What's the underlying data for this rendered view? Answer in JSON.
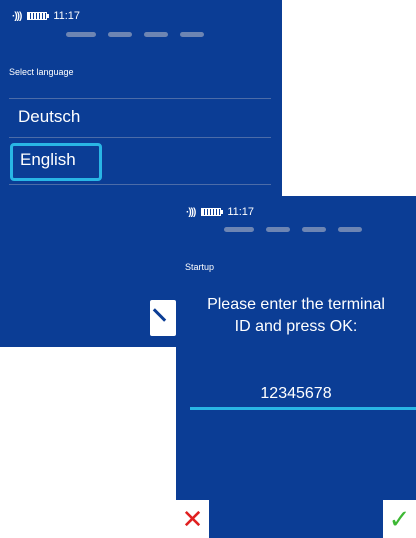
{
  "screen1": {
    "status": {
      "nfc_icon": "contactless-icon",
      "battery_icon": "battery-icon",
      "time": "11:17"
    },
    "title": "Select language",
    "languages": [
      "Deutsch",
      "English"
    ],
    "selected": "English"
  },
  "screen2": {
    "status": {
      "nfc_icon": "contactless-icon",
      "battery_icon": "battery-icon",
      "time": "11:17"
    },
    "title": "Startup",
    "prompt_line1": "Please enter the terminal",
    "prompt_line2": "ID and press OK:",
    "terminal_id": "12345678",
    "cancel_symbol": "✕",
    "ok_symbol": "✓"
  },
  "colors": {
    "background": "#0b3d95",
    "accent": "#29b6e5",
    "cancel": "#e02020",
    "ok": "#3db834"
  }
}
